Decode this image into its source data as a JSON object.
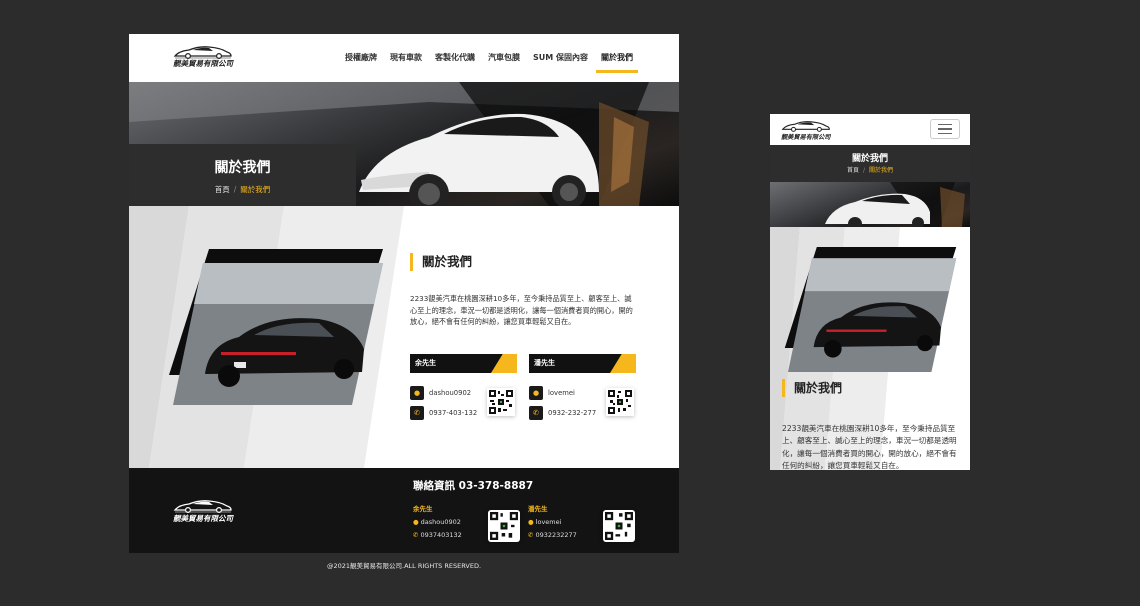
{
  "brand": {
    "name": "靚美貿易有限公司",
    "accent": "#f5b71b"
  },
  "nav": {
    "items": [
      "授權廠牌",
      "現有車款",
      "客製化代購",
      "汽車包膜",
      "SUM 保固內容",
      "關於我們"
    ],
    "active_index": 5
  },
  "hero": {
    "title": "關於我們",
    "breadcrumb": {
      "home": "首頁",
      "sep": "/",
      "current": "關於我們"
    }
  },
  "about": {
    "title": "關於我們",
    "description": "2233靚美汽車在桃園深耕10多年，至今秉持品質至上、顧客至上、誠心至上的理念，車況一切都是透明化，讓每一個消費者買的開心，開的放心，絕不會有任何的糾紛，讓您買車輕鬆又自在。"
  },
  "contacts": [
    {
      "name": "余先生",
      "line_id": "dashou0902",
      "phone": "0937-403-132"
    },
    {
      "name": "潘先生",
      "line_id": "lovemei",
      "phone": "0932-232-277"
    }
  ],
  "footer": {
    "title": "聯絡資訊 03-378-8887",
    "contacts": [
      {
        "name": "余先生",
        "line_id": "dashou0902",
        "phone": "0937403132"
      },
      {
        "name": "潘先生",
        "line_id": "lovemei",
        "phone": "0932232277"
      }
    ],
    "copyright": "@2021靚美貿易有限公司.ALL RIGHTS RESERVED."
  },
  "icons": {
    "line": "line-icon",
    "phone": "phone-icon",
    "menu": "hamburger-menu-icon"
  }
}
